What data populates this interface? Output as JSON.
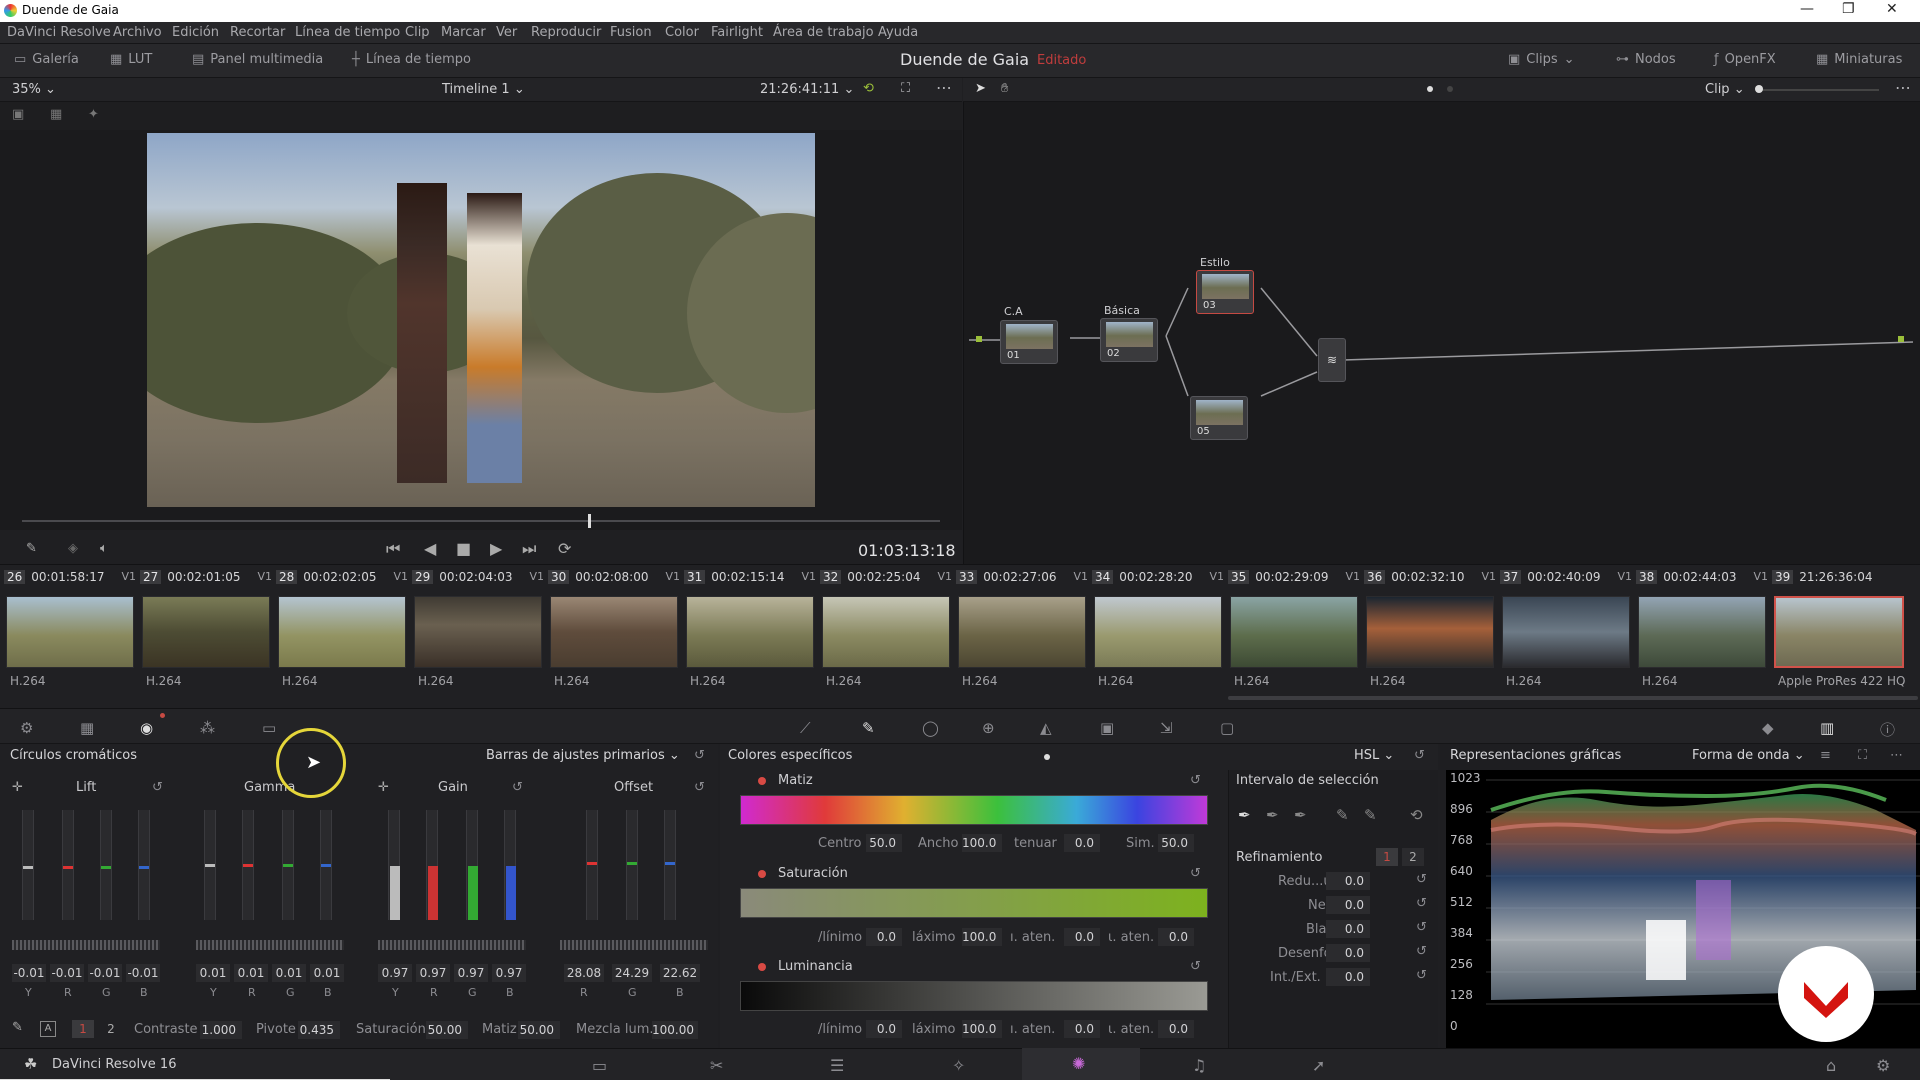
{
  "window": {
    "title": "Duende de Gaia",
    "minimize": "—",
    "maximize": "❐",
    "close": "✕"
  },
  "menu": [
    "DaVinci Resolve",
    "Archivo",
    "Edición",
    "Recortar",
    "Línea de tiempo",
    "Clip",
    "Marcar",
    "Ver",
    "Reproducir",
    "Fusion",
    "Color",
    "Fairlight",
    "Área de trabajo",
    "Ayuda"
  ],
  "toolbar": {
    "left": [
      "Galería",
      "LUT",
      "Panel multimedia",
      "Línea de tiempo"
    ],
    "project": "Duende de Gaia",
    "status": "Editado",
    "right": [
      "Clips",
      "Nodos",
      "OpenFX",
      "Miniaturas"
    ]
  },
  "viewer": {
    "zoom": "35%",
    "timeline": "Timeline 1",
    "timecode_top": "21:26:41:11",
    "timecode": "01:03:13:18",
    "clip_mode": "Clip"
  },
  "nodes": [
    {
      "label": "C.A",
      "num": "01"
    },
    {
      "label": "Básica",
      "num": "02"
    },
    {
      "label": "Estilo",
      "num": "03"
    },
    {
      "label": "",
      "num": "05"
    }
  ],
  "clips": [
    {
      "n": "26",
      "tc": "00:01:58:17",
      "v": "V1",
      "codec": "H.264"
    },
    {
      "n": "27",
      "tc": "00:02:01:05",
      "v": "V1",
      "codec": "H.264"
    },
    {
      "n": "28",
      "tc": "00:02:02:05",
      "v": "V1",
      "codec": "H.264"
    },
    {
      "n": "29",
      "tc": "00:02:04:03",
      "v": "V1",
      "codec": "H.264"
    },
    {
      "n": "30",
      "tc": "00:02:08:00",
      "v": "V1",
      "codec": "H.264"
    },
    {
      "n": "31",
      "tc": "00:02:15:14",
      "v": "V1",
      "codec": "H.264"
    },
    {
      "n": "32",
      "tc": "00:02:25:04",
      "v": "V1",
      "codec": "H.264"
    },
    {
      "n": "33",
      "tc": "00:02:27:06",
      "v": "V1",
      "codec": "H.264"
    },
    {
      "n": "34",
      "tc": "00:02:28:20",
      "v": "V1",
      "codec": "H.264"
    },
    {
      "n": "35",
      "tc": "00:02:29:09",
      "v": "V1",
      "codec": "H.264"
    },
    {
      "n": "36",
      "tc": "00:02:32:10",
      "v": "V1",
      "codec": "H.264"
    },
    {
      "n": "37",
      "tc": "00:02:40:09",
      "v": "V1",
      "codec": "H.264"
    },
    {
      "n": "38",
      "tc": "00:02:44:03",
      "v": "V1",
      "codec": "H.264"
    },
    {
      "n": "39",
      "tc": "21:26:36:04",
      "v": "",
      "codec": "Apple ProRes 422 HQ"
    }
  ],
  "color_wheels": {
    "title": "Círculos cromáticos",
    "mode": "Barras de ajustes primarios",
    "groups": [
      {
        "name": "Lift",
        "values": [
          "-0.01",
          "-0.01",
          "-0.01",
          "-0.01"
        ],
        "channels": [
          "Y",
          "R",
          "G",
          "B"
        ]
      },
      {
        "name": "Gamma",
        "values": [
          "0.01",
          "0.01",
          "0.01",
          "0.01"
        ],
        "channels": [
          "Y",
          "R",
          "G",
          "B"
        ]
      },
      {
        "name": "Gain",
        "values": [
          "0.97",
          "0.97",
          "0.97",
          "0.97"
        ],
        "channels": [
          "Y",
          "R",
          "G",
          "B"
        ]
      },
      {
        "name": "Offset",
        "values": [
          "28.08",
          "24.29",
          "22.62"
        ],
        "channels": [
          "R",
          "G",
          "B"
        ]
      }
    ],
    "bottom": {
      "page1": "1",
      "page2": "2",
      "contrast_label": "Contraste",
      "contrast": "1.000",
      "pivot_label": "Pivote",
      "pivot": "0.435",
      "sat_label": "Saturación",
      "sat": "50.00",
      "hue_label": "Matiz",
      "hue": "50.00",
      "lum_label": "Mezcla lum.",
      "lum": "100.00"
    }
  },
  "specific": {
    "title": "Colores específicos",
    "mode": "HSL",
    "hue": {
      "label": "Matiz",
      "centro_l": "Centro",
      "centro": "50.0",
      "ancho_l": "Ancho",
      "ancho": "100.0",
      "tenuar_l": "tenuar",
      "tenuar": "0.0",
      "sim_l": "Sim.",
      "sim": "50.0"
    },
    "sat": {
      "label": "Saturación",
      "min_l": "/línimo",
      "min": "0.0",
      "max_l": "láximo",
      "max": "100.0",
      "ba_l": "ı. aten.",
      "ba": "0.0",
      "aa_l": "ι. aten.",
      "aa": "0.0"
    },
    "lum": {
      "label": "Luminancia",
      "min_l": "/línimo",
      "min": "0.0",
      "max_l": "láximo",
      "max": "100.0",
      "ba_l": "ı. aten.",
      "ba": "0.0",
      "aa_l": "ι. aten.",
      "aa": "0.0"
    },
    "range_title": "Intervalo de selección",
    "refine_title": "Refinamiento",
    "refine_tabs": [
      "1",
      "2"
    ],
    "refine": [
      {
        "label": "Redu...uido",
        "value": "0.0"
      },
      {
        "label": "Negro",
        "value": "0.0"
      },
      {
        "label": "Blanco",
        "value": "0.0"
      },
      {
        "label": "Desenfoque",
        "value": "0.0"
      },
      {
        "label": "Int./Ext.",
        "value": "0.0"
      }
    ]
  },
  "scopes": {
    "title": "Representaciones gráficas",
    "mode": "Forma de onda",
    "ticks": [
      "1023",
      "896",
      "768",
      "640",
      "512",
      "384",
      "256",
      "128",
      "0"
    ]
  },
  "app": {
    "name": "DaVinci Resolve 16"
  },
  "colors": {
    "accent_red": "#c64a43",
    "status_red": "#c03d3d"
  }
}
